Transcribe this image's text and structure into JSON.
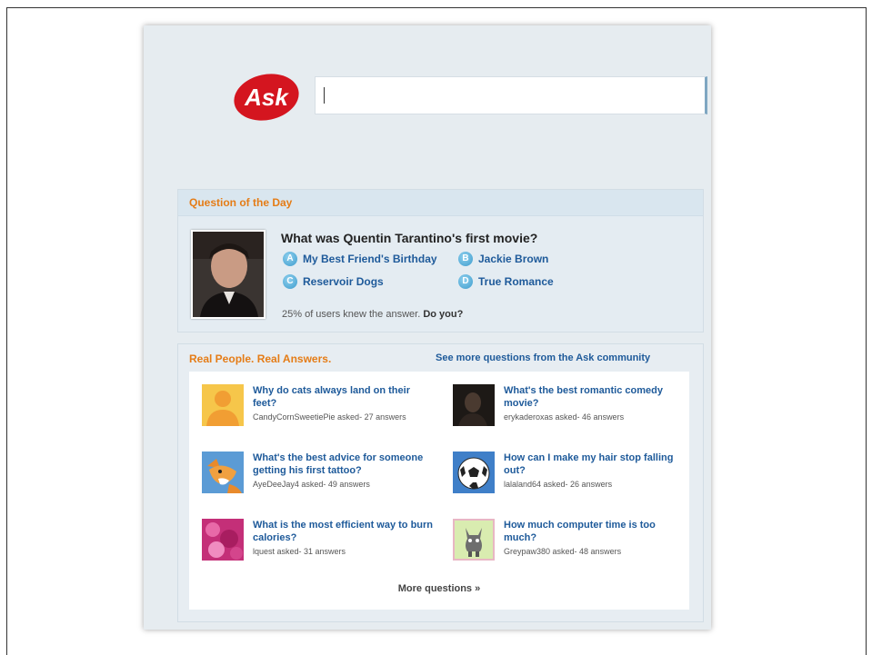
{
  "logo_text": "Ask",
  "search": {
    "value": "",
    "placeholder": ""
  },
  "qotd": {
    "heading": "Question of the Day",
    "question": "What was Quentin Tarantino's first movie?",
    "options": [
      {
        "letter": "A",
        "label": "My Best Friend's Birthday"
      },
      {
        "letter": "B",
        "label": "Jackie Brown"
      },
      {
        "letter": "C",
        "label": "Reservoir Dogs"
      },
      {
        "letter": "D",
        "label": "True Romance"
      }
    ],
    "footer_text": "25% of users knew the answer.",
    "footer_bold": "Do you?"
  },
  "rpra": {
    "heading": "Real People. Real Answers.",
    "see_more": "See more questions from the Ask community",
    "questions": [
      {
        "title": "Why do cats always land on their feet?",
        "meta": "CandyCornSweetiePie asked- 27 answers",
        "icon": "avatar-silhouette-icon"
      },
      {
        "title": "What's the best romantic comedy movie?",
        "meta": "erykaderoxas asked- 46 answers",
        "icon": "dark-photo-avatar"
      },
      {
        "title": "What's the best advice for someone getting his first tattoo?",
        "meta": "AyeDeeJay4 asked- 49 answers",
        "icon": "fox-avatar-icon"
      },
      {
        "title": "How can I make my hair stop falling out?",
        "meta": "lalaland64 asked- 26 answers",
        "icon": "soccer-ball-avatar-icon"
      },
      {
        "title": "What is the most efficient way to burn calories?",
        "meta": "lquest asked- 31 answers",
        "icon": "pink-texture-avatar"
      },
      {
        "title": "How much computer time is too much?",
        "meta": "Greypaw380 asked- 48 answers",
        "icon": "cartoon-creature-avatar"
      }
    ],
    "more_label": "More questions »"
  },
  "colors": {
    "brand_red": "#d4151f",
    "orange": "#e57c16",
    "link_blue": "#1e5a9a"
  }
}
